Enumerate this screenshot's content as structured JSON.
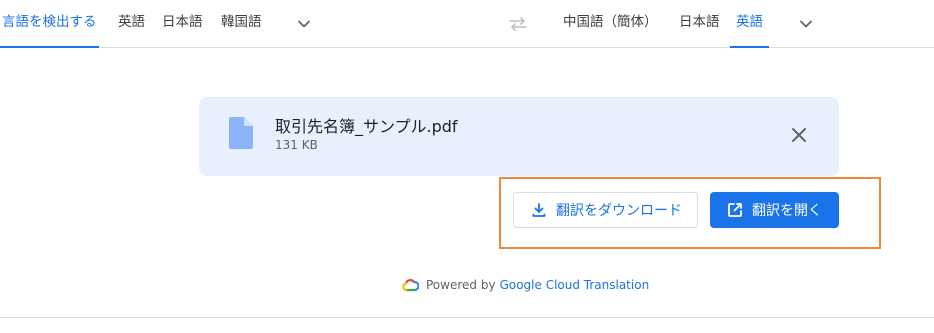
{
  "source_tabs": {
    "detect_label": "言語を検出する",
    "lang1": "英語",
    "lang2": "日本語",
    "lang3": "韓国語"
  },
  "target_tabs": {
    "lang1": "中国語（簡体）",
    "lang2": "日本語",
    "lang3": "英語"
  },
  "icons": {
    "source_more": "chevron-down-icon",
    "swap": "swap-languages-icon",
    "target_more": "chevron-down-icon",
    "file": "document-file-icon",
    "close": "close-icon",
    "download": "download-icon",
    "open": "open-in-new-icon",
    "cloud_logo": "google-cloud-logo"
  },
  "file": {
    "name": "取引先名簿_サンプル.pdf",
    "size": "131 KB"
  },
  "actions": {
    "download_label": "翻訳をダウンロード",
    "open_label": "翻訳を開く"
  },
  "footer": {
    "powered_by": "Powered by",
    "service_link": "Google Cloud Translation"
  },
  "colors": {
    "accent": "#1a73e8",
    "card_background": "#e8f0fe",
    "highlight_border": "#ef8a3a"
  }
}
